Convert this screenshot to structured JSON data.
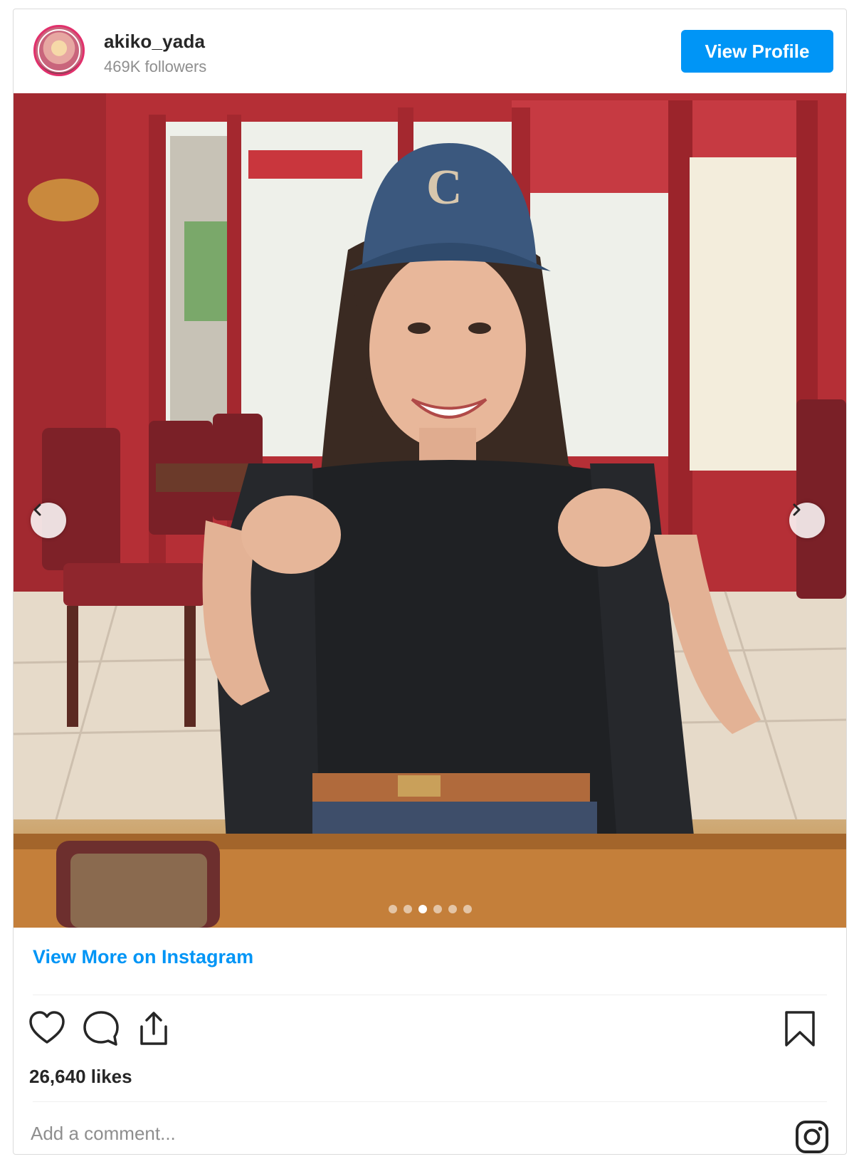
{
  "post": {
    "username": "akiko_yada",
    "followers": "469K followers",
    "view_profile_label": "View Profile",
    "view_more_label": "View More on Instagram",
    "likes": "26,640 likes",
    "comment_placeholder": "Add a comment...",
    "carousel": {
      "total_slides": 6,
      "active_index": 2
    }
  },
  "icons": {
    "avatar": "profile-avatar",
    "prev": "chevron-left-icon",
    "next": "chevron-right-icon",
    "like": "heart-icon",
    "comment": "comment-bubble-icon",
    "share": "share-icon",
    "save": "bookmark-icon",
    "logo": "instagram-logo-icon"
  },
  "colors": {
    "accent": "#0095f6",
    "text": "#262626",
    "muted": "#8e8e8e",
    "border": "#dbdbdb"
  }
}
